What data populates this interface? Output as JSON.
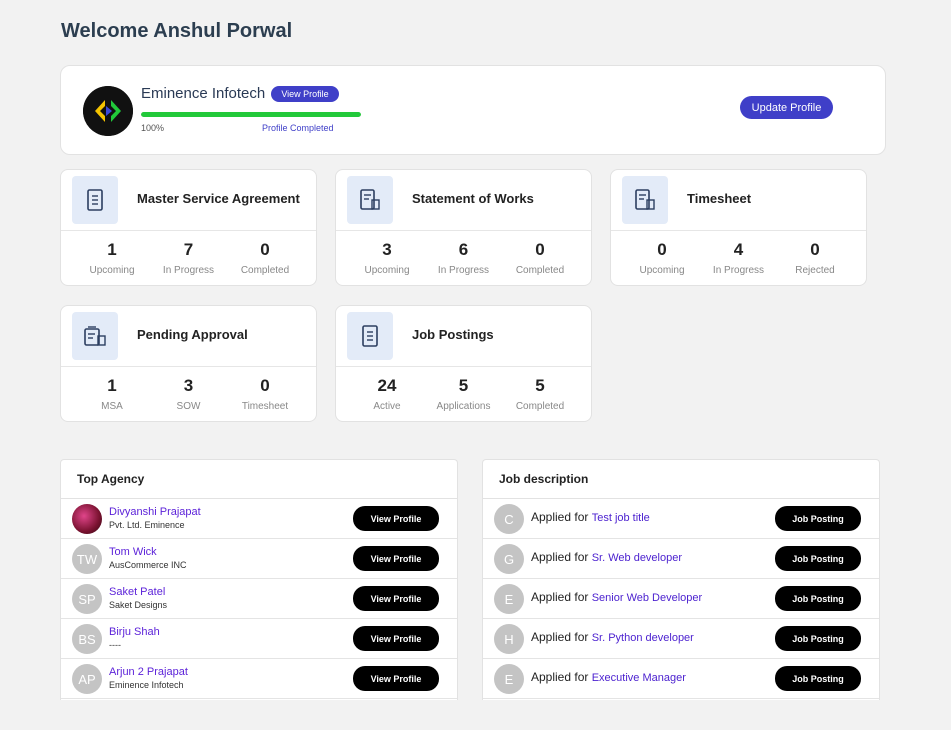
{
  "welcome": "Welcome Anshul Porwal",
  "profile": {
    "company": "Eminence Infotech",
    "view_profile_label": "View Profile",
    "progress_percent": 100,
    "progress_text": "100%",
    "progress_label": "Profile Completed",
    "update_label": "Update Profile"
  },
  "stats": [
    {
      "title": "Master Service Agreement",
      "icon": "document-icon",
      "items": [
        {
          "value": "1",
          "label": "Upcoming"
        },
        {
          "value": "7",
          "label": "In Progress"
        },
        {
          "value": "0",
          "label": "Completed"
        }
      ]
    },
    {
      "title": "Statement of Works",
      "icon": "document-edit-icon",
      "items": [
        {
          "value": "3",
          "label": "Upcoming"
        },
        {
          "value": "6",
          "label": "In Progress"
        },
        {
          "value": "0",
          "label": "Completed"
        }
      ]
    },
    {
      "title": "Timesheet",
      "icon": "document-edit-icon",
      "items": [
        {
          "value": "0",
          "label": "Upcoming"
        },
        {
          "value": "4",
          "label": "In Progress"
        },
        {
          "value": "0",
          "label": "Rejected"
        }
      ]
    },
    {
      "title": "Pending Approval",
      "icon": "approval-icon",
      "items": [
        {
          "value": "1",
          "label": "MSA"
        },
        {
          "value": "3",
          "label": "SOW"
        },
        {
          "value": "0",
          "label": "Timesheet"
        }
      ]
    },
    {
      "title": "Job Postings",
      "icon": "document-icon",
      "items": [
        {
          "value": "24",
          "label": "Active"
        },
        {
          "value": "5",
          "label": "Applications"
        },
        {
          "value": "5",
          "label": "Completed"
        }
      ]
    }
  ],
  "top_agency": {
    "title": "Top Agency",
    "button_label": "View Profile",
    "rows": [
      {
        "initials": "",
        "name": "Divyanshi Prajapat",
        "sub": "Pvt. Ltd. Eminence"
      },
      {
        "initials": "TW",
        "name": "Tom Wick",
        "sub": "AusCommerce INC"
      },
      {
        "initials": "SP",
        "name": "Saket Patel",
        "sub": "Saket Designs"
      },
      {
        "initials": "BS",
        "name": "Birju Shah",
        "sub": "----"
      },
      {
        "initials": "AP",
        "name": "Arjun 2 Prajapat",
        "sub": "Eminence Infotech"
      }
    ]
  },
  "job_description": {
    "title": "Job description",
    "applied_prefix": "Applied for",
    "button_label": "Job Posting",
    "rows": [
      {
        "initial": "C",
        "job": "Test job title"
      },
      {
        "initial": "G",
        "job": "Sr. Web developer"
      },
      {
        "initial": "E",
        "job": "Senior Web Developer"
      },
      {
        "initial": "H",
        "job": "Sr. Python developer"
      },
      {
        "initial": "E",
        "job": "Executive Manager"
      }
    ]
  },
  "colors": {
    "accent": "#3f3fc8",
    "progress": "#22c93a",
    "link": "#5a1fd8"
  }
}
